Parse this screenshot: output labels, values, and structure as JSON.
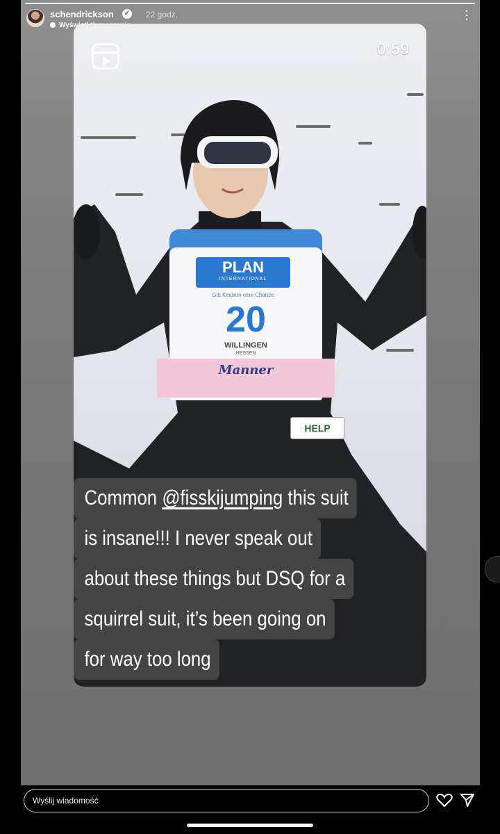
{
  "header": {
    "username": "schendrickson",
    "time": "22 godz.",
    "translate": "Wyświetl tłumaczenie"
  },
  "video": {
    "duration": "0:59",
    "bib": {
      "logo": "PLAN",
      "logo_sub": "INTERNATIONAL",
      "tagline": "Gib Kindern eine Chance",
      "number": "20",
      "event": "WILLINGEN",
      "event_sub": "HESSEN",
      "sponsor": "Manner",
      "patch": "HELP"
    }
  },
  "caption": {
    "line1_pre": "Common ",
    "mention": "@fisskijumping",
    "line1_post": " this suit",
    "line2": "is insane!!! I never speak out",
    "line3": "about these things but DSQ for a",
    "line4": "squirrel suit, it’s been going on",
    "line5": "for way too long"
  },
  "footer": {
    "reply_placeholder": "Wyślij wiadomość"
  },
  "icons": {
    "reel": "reel-icon",
    "more": "more-options-icon",
    "heart": "heart-icon",
    "send": "send-icon"
  }
}
